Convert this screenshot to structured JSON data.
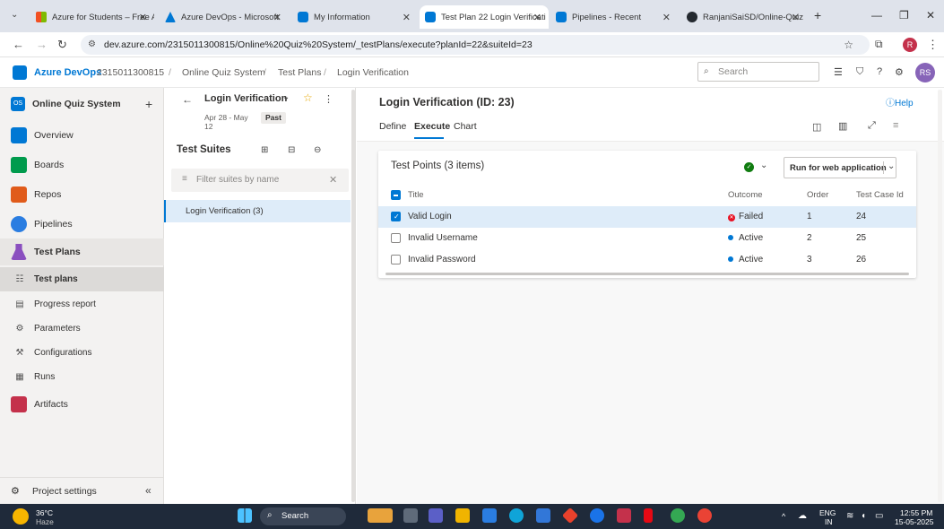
{
  "browser": {
    "tabs": [
      {
        "label": "Azure for Students – Free A",
        "color": "#f25022"
      },
      {
        "label": "Azure DevOps - Microsoft",
        "color": "#0078d4"
      },
      {
        "label": "My Information",
        "color": "#0078d4"
      },
      {
        "label": "Test Plan 22 Login Verificati",
        "color": "#0078d4"
      },
      {
        "label": "Pipelines - Recent",
        "color": "#0078d4"
      },
      {
        "label": "RanjaniSaiSD/Online-Quiz",
        "color": "#24292f"
      }
    ],
    "url": "dev.azure.com/2315011300815/Online%20Quiz%20System/_testPlans/execute?planId=22&suiteId=23",
    "profile_initial": "R"
  },
  "header": {
    "brand": "Azure DevOps",
    "org": "2315011300815",
    "breadcrumbs": [
      "Online Quiz System",
      "Test Plans",
      "Login Verification"
    ],
    "search_placeholder": "Search",
    "user_initials": "RS"
  },
  "sidebar": {
    "project_badge": "OS",
    "project_name": "Online Quiz System",
    "items": [
      {
        "label": "Overview",
        "color": "#0078d4"
      },
      {
        "label": "Boards",
        "color": "#009b4d"
      },
      {
        "label": "Repos",
        "color": "#e05b1a"
      },
      {
        "label": "Pipelines",
        "color": "#2a7de1"
      },
      {
        "label": "Test Plans",
        "color": "#8a4fbf"
      }
    ],
    "subitems": [
      {
        "label": "Test plans",
        "icon": "☷"
      },
      {
        "label": "Progress report",
        "icon": "▤"
      },
      {
        "label": "Parameters",
        "icon": "⚙"
      },
      {
        "label": "Configurations",
        "icon": "⚒"
      },
      {
        "label": "Runs",
        "icon": "▦"
      }
    ],
    "artifacts": {
      "label": "Artifacts",
      "color": "#c4314b"
    },
    "settings": "Project settings",
    "collapse": "«"
  },
  "suites_pane": {
    "plan_name": "Login Verification",
    "dates": "Apr 28 - May 12",
    "status_badge": "Past",
    "title": "Test Suites",
    "filter_placeholder": "Filter suites by name",
    "suites": [
      {
        "label": "Login Verification (3)"
      }
    ]
  },
  "detail": {
    "title": "Login Verification (ID: 23)",
    "help": "Help",
    "tabs": [
      "Define",
      "Execute",
      "Chart"
    ],
    "active_tab": "Execute",
    "points_title": "Test Points (3 items)",
    "run_button": "Run for web application",
    "columns": [
      "Title",
      "Outcome",
      "Order",
      "Test Case Id"
    ],
    "rows": [
      {
        "title": "Valid Login",
        "outcome": "Failed",
        "outcome_color": "#e81123",
        "order": "1",
        "id": "24",
        "selected": true
      },
      {
        "title": "Invalid Username",
        "outcome": "Active",
        "outcome_color": "#0078d4",
        "order": "2",
        "id": "25",
        "selected": false
      },
      {
        "title": "Invalid Password",
        "outcome": "Active",
        "outcome_color": "#0078d4",
        "order": "3",
        "id": "26",
        "selected": false
      }
    ]
  },
  "taskbar": {
    "weather_temp": "36°C",
    "weather_desc": "Haze",
    "search": "Search",
    "lang": "ENG",
    "region": "IN",
    "time": "12:55 PM",
    "date": "15-05-2025"
  },
  "colors": {
    "accent": "#0078d4",
    "selected_row": "#deecf9",
    "selected_suite": "#deecf9"
  }
}
